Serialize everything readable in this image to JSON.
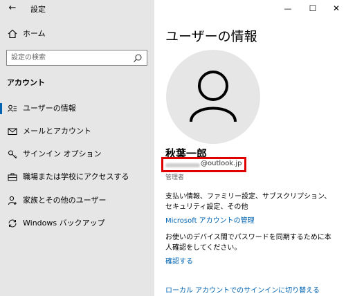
{
  "window": {
    "title": "設定",
    "minimize_glyph": "—",
    "maximize_glyph": "☐",
    "close_glyph": "✕"
  },
  "sidebar": {
    "back_glyph": "←",
    "home_label": "ホーム",
    "search_placeholder": "設定の検索",
    "section_title": "アカウント",
    "items": [
      {
        "label": "ユーザーの情報",
        "icon": "user-info-icon",
        "active": true
      },
      {
        "label": "メールとアカウント",
        "icon": "mail-icon",
        "active": false
      },
      {
        "label": "サインイン オプション",
        "icon": "key-icon",
        "active": false
      },
      {
        "label": "職場または学校にアクセスする",
        "icon": "briefcase-icon",
        "active": false
      },
      {
        "label": "家族とその他のユーザー",
        "icon": "person-add-icon",
        "active": false
      },
      {
        "label": "Windows バックアップ",
        "icon": "sync-icon",
        "active": false
      }
    ]
  },
  "main": {
    "title": "ユーザーの情報",
    "user_name": "秋葉一郎",
    "email_domain": "@outlook.jp",
    "role": "管理者",
    "info_text": "支払い情報、ファミリー設定、サブスクリプション、セキュリティ設定、その他",
    "manage_link": "Microsoft アカウントの管理",
    "verify_text": "お使いのデバイス間でパスワードを同期するために本人確認をしてください。",
    "verify_link": "確認する",
    "local_account_link": "ローカル アカウントでのサインインに切り替える"
  },
  "colors": {
    "accent": "#0063b1",
    "sidebar_bg": "#e6e6e6",
    "highlight_border": "#e00000"
  }
}
